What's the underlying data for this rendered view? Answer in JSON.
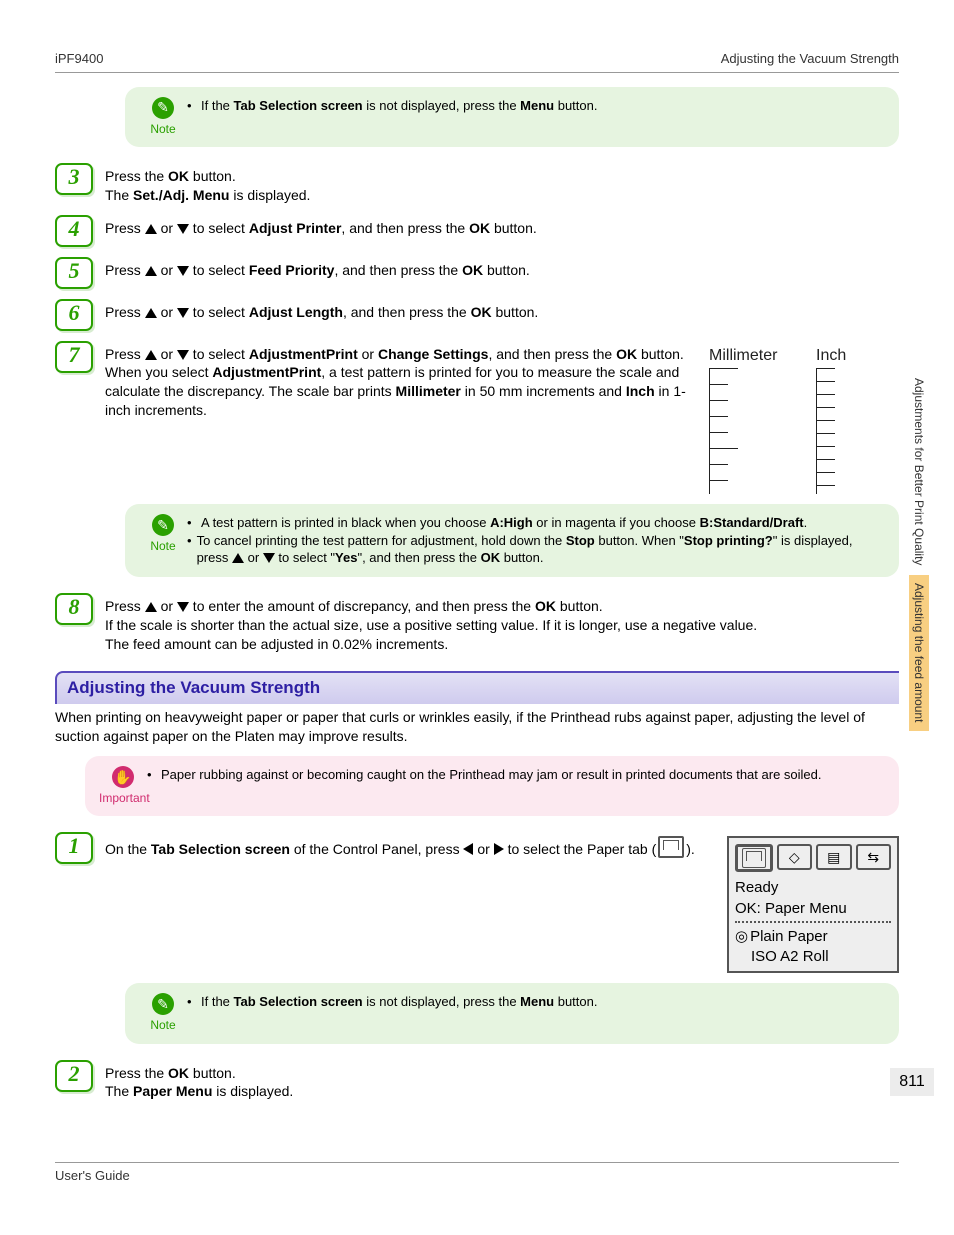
{
  "header": {
    "left": "iPF9400",
    "right": "Adjusting the Vacuum Strength"
  },
  "footer": {
    "left": "User's Guide"
  },
  "side": {
    "tab1": "Adjustments for Better Print Quality",
    "tab2": "Adjusting the feed amount"
  },
  "page_number": "811",
  "note_label": "Note",
  "important_label": "Important",
  "note0": {
    "prefix": "If the ",
    "b1": "Tab Selection screen",
    "mid": " is not displayed, press the ",
    "b2": "Menu",
    "suffix": " button."
  },
  "step3": {
    "num": "3",
    "l1a": "Press the ",
    "l1b": "OK",
    "l1_suf": " button.",
    "l2a": "The ",
    "l2b": "Set./Adj. Menu",
    "l2_suf": " is displayed."
  },
  "step4": {
    "num": "4",
    "pre": "Press ",
    "mid": " or ",
    "sel_pre": " to select ",
    "b": "Adjust Printer",
    "then": ", and then press the ",
    "ok": "OK",
    "suf": " button."
  },
  "step5": {
    "num": "5",
    "pre": "Press ",
    "mid": " or ",
    "sel_pre": " to select ",
    "b": "Feed Priority",
    "then": ", and then press the ",
    "ok": "OK",
    "suf": " button."
  },
  "step6": {
    "num": "6",
    "pre": "Press ",
    "mid": " or ",
    "sel_pre": " to select ",
    "b": "Adjust Length",
    "then": ", and then press the ",
    "ok": "OK",
    "suf": " button."
  },
  "step7": {
    "num": "7",
    "pre": "Press ",
    "mid": " or ",
    "sel_pre": " to select ",
    "b1": "AdjustmentPrint",
    "or": " or ",
    "b2": "Change Settings",
    "then": ", and then press the ",
    "ok": "OK",
    "suf": " button.",
    "l2a": "When you select ",
    "l2b": "AdjustmentPrint",
    "l2c": ", a test pattern is printed for you to measure the scale and calculate the discrepancy. The scale bar prints ",
    "l2d": "Millimeter",
    "l2e": " in 50 mm increments and ",
    "l2f": "Inch",
    "l2g": " in 1-inch increments.",
    "scale": {
      "mm": "Millimeter",
      "in": "Inch"
    }
  },
  "note7": {
    "b1a": "A test pattern is printed in black when you choose ",
    "b1b": "A:High",
    "b1c": " or in magenta if you choose ",
    "b1d": "B:Standard/Draft",
    "b1e": ".",
    "b2a": "To cancel printing the test pattern for adjustment, hold down the ",
    "b2b": "Stop",
    "b2c": " button. When \"",
    "b2d": "Stop printing?",
    "b2e": "\" is displayed, press ",
    "b2mid": " or ",
    "b2f": " to select \"",
    "b2g": "Yes",
    "b2h": "\", and then press the ",
    "b2i": "OK",
    "b2j": " button."
  },
  "step8": {
    "num": "8",
    "pre": "Press ",
    "mid": " or ",
    "rest": " to enter the amount of discrepancy, and then press the ",
    "ok": "OK",
    "suf": " button.",
    "l2": "If the scale is shorter than the actual size, use a positive setting value. If it is longer, use a negative value.",
    "l3": "The feed amount can be adjusted in 0.02% increments."
  },
  "section2": {
    "title": "Adjusting the Vacuum Strength",
    "intro": "When printing on heavyweight paper or paper that curls or wrinkles easily, if the Printhead rubs against paper, adjusting the level of suction against paper on the Platen may improve results."
  },
  "imp2": {
    "text": "Paper rubbing against or becoming caught on the Printhead may jam or result in printed documents that are soiled."
  },
  "s2step1": {
    "num": "1",
    "a": "On the ",
    "b": "Tab Selection screen",
    "c": " of the Control Panel, press ",
    "mid": " or ",
    "d": " to select the Paper tab (",
    "e": ")."
  },
  "lcd": {
    "ready": "Ready",
    "ok": "OK: Paper Menu",
    "media": "Plain Paper",
    "size": "ISO A2 Roll"
  },
  "note2": {
    "prefix": "If the ",
    "b1": "Tab Selection screen",
    "mid": " is not displayed, press the ",
    "b2": "Menu",
    "suffix": " button."
  },
  "s2step2": {
    "num": "2",
    "l1a": "Press the ",
    "l1b": "OK",
    "l1_suf": " button.",
    "l2a": "The ",
    "l2b": "Paper Menu",
    "l2_suf": " is displayed."
  }
}
